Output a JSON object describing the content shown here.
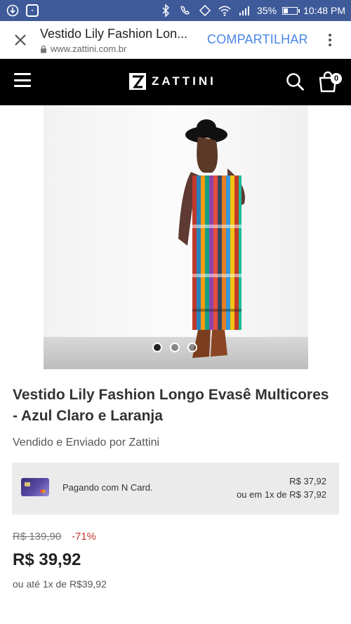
{
  "status_bar": {
    "battery": "35%",
    "battery_level": 0.35,
    "time": "10:48 PM",
    "left_icons": [
      "download-icon",
      "app-notification-icon"
    ],
    "right_icons": [
      "bluetooth-icon",
      "call-icon",
      "vibrate-icon",
      "wifi-icon",
      "signal-icon",
      "battery-icon"
    ]
  },
  "browser": {
    "page_title": "Vestido Lily Fashion Lon...",
    "url": "www.zattini.com.br",
    "share_label": "COMPARTILHAR"
  },
  "site": {
    "brand": "ZATTINI",
    "cart_count": "0"
  },
  "carousel": {
    "dot_count": 3,
    "active_index": 0
  },
  "product": {
    "title": "Vestido Lily Fashion Longo Evasê Multicores - Azul Claro e Laranja",
    "seller": "Vendido e Enviado por Zattini",
    "card_offer": {
      "label": "Pagando com N Card.",
      "price": "R$ 37,92",
      "installment": "ou em 1x de R$ 37,92"
    },
    "old_price": "R$ 139,90",
    "discount": "-71%",
    "price": "R$ 39,92",
    "installment": "ou até 1x de R$39,92"
  },
  "colors": {
    "status_bar": "#3f5a99",
    "header": "#000000",
    "share_link": "#4a86e8",
    "discount": "#c0392b"
  }
}
